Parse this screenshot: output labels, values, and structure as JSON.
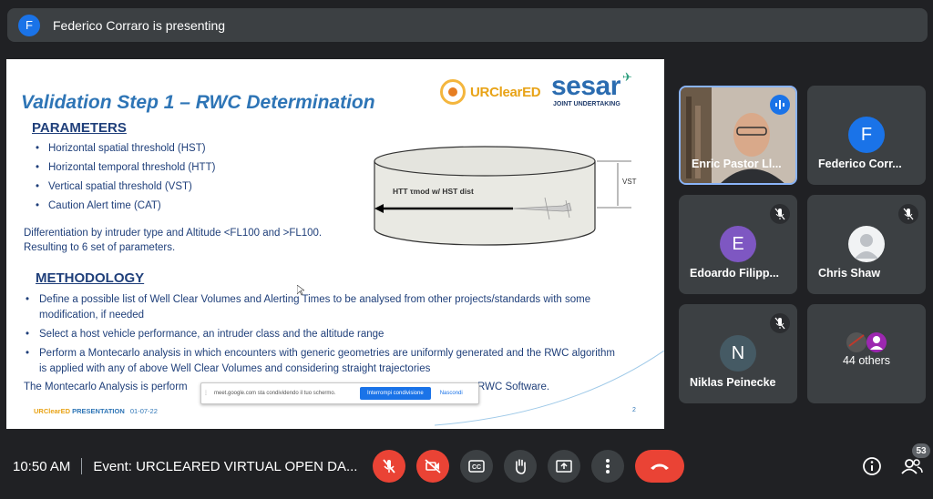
{
  "banner": {
    "avatar_letter": "F",
    "text": "Federico Corraro is presenting"
  },
  "slide": {
    "title": "Validation Step 1 – RWC Determination",
    "logo_urcleared": "URClearED",
    "logo_sesar": "sesar",
    "logo_sesar_sub": "JOINT UNDERTAKING",
    "parameters_heading": "PARAMETERS",
    "parameters": [
      "Horizontal spatial threshold (HST)",
      "Horizontal temporal threshold (HTT)",
      "Vertical spatial threshold (VST)",
      "Caution Alert time (CAT)"
    ],
    "differentiation_line1": "Differentiation by intruder type and Altitude <FL100 and >FL100.",
    "differentiation_line2": "Resulting to 6 set of parameters.",
    "diagram_htt_label": "HTT τmod  w/ HST dist",
    "diagram_vst_label": "VST",
    "methodology_heading": "METHODOLOGY",
    "methodology": [
      "Define a possible list of Well Clear Volumes and Alerting Times to be analysed from other projects/standards with some modification, if needed",
      "Select a host vehicle performance, an intruder class and the altitude range",
      "Perform a Montecarlo analysis in which encounters with generic geometries are uniformly generated and the RWC algorithm is applied with any of above Well Clear Volumes and considering straight trajectories"
    ],
    "montecarlo_left": "The Montecarlo Analysis is perform",
    "montecarlo_right": "RWC Software.",
    "footer_brand_a": "URClearED",
    "footer_brand_b": "PRESENTATION",
    "footer_date": "01-07-22",
    "page_number": "2"
  },
  "share_bar": {
    "message": "meet.google.com sta condividendo il tuo schermo.",
    "stop_label": "Interrompi condivisione",
    "hide_label": "Nascondi"
  },
  "participants": [
    {
      "name": "Enric Pastor Ll...",
      "type": "video"
    },
    {
      "name": "Federico Corr...",
      "letter": "F",
      "color": "#1a73e8"
    },
    {
      "name": "Edoardo Filipp...",
      "letter": "E",
      "color": "#7e57c2"
    },
    {
      "name": "Chris Shaw",
      "type": "photo"
    },
    {
      "name": "Niklas Peinecke",
      "letter": "N",
      "color": "#455a64"
    },
    {
      "name": "44 others",
      "type": "group"
    }
  ],
  "bottom": {
    "time": "10:50 AM",
    "event": "Event: URCLEARED VIRTUAL OPEN DA...",
    "people_count": "53"
  }
}
